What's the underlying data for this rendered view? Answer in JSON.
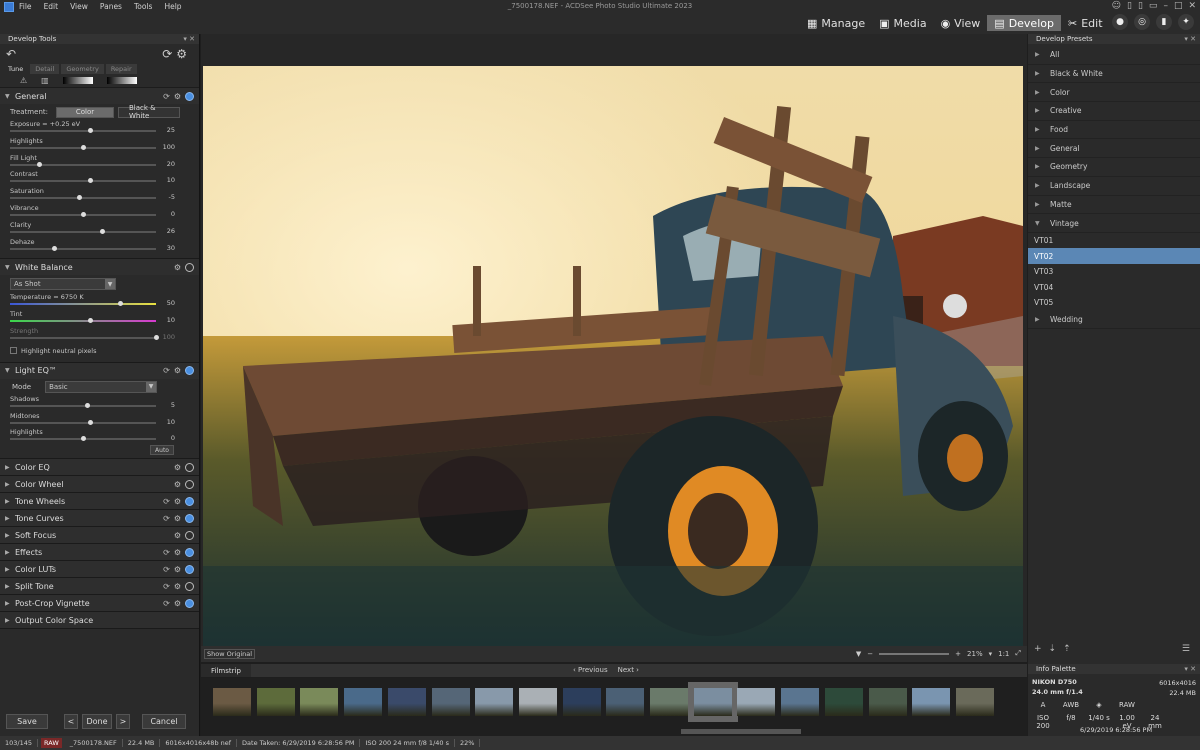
{
  "window": {
    "title": "_7500178.NEF - ACDSee Photo Studio Ultimate 2023"
  },
  "menu": [
    "File",
    "Edit",
    "View",
    "Panes",
    "Tools",
    "Help"
  ],
  "modes": [
    {
      "label": "Manage",
      "icon": "grid-icon"
    },
    {
      "label": "Media",
      "icon": "media-icon"
    },
    {
      "label": "View",
      "icon": "eye-icon"
    },
    {
      "label": "Develop",
      "icon": "develop-icon",
      "active": true
    },
    {
      "label": "Edit",
      "icon": "tools-icon"
    }
  ],
  "develop_tools": {
    "title": "Develop Tools",
    "tabs": [
      "Tune",
      "Detail",
      "Geometry",
      "Repair"
    ],
    "general": {
      "title": "General",
      "treatment_label": "Treatment:",
      "color_btn": "Color",
      "bw_btn": "Black & White",
      "sliders": [
        {
          "label": "Exposure = +0.25 eV",
          "value": "25",
          "pos": 0.55
        },
        {
          "label": "Highlights",
          "value": "100",
          "pos": 0.5
        },
        {
          "label": "Fill Light",
          "value": "20",
          "pos": 0.2
        },
        {
          "label": "Contrast",
          "value": "10",
          "pos": 0.55
        },
        {
          "label": "Saturation",
          "value": "-5",
          "pos": 0.47
        },
        {
          "label": "Vibrance",
          "value": "0",
          "pos": 0.5
        },
        {
          "label": "Clarity",
          "value": "26",
          "pos": 0.63
        },
        {
          "label": "Dehaze",
          "value": "30",
          "pos": 0.3
        }
      ]
    },
    "white_balance": {
      "title": "White Balance",
      "preset": "As Shot",
      "sliders": [
        {
          "label": "Temperature = 6750 K",
          "value": "50",
          "pos": 0.75,
          "gradient": "linear-gradient(90deg,#3a57d8,#e8e040)"
        },
        {
          "label": "Tint",
          "value": "10",
          "pos": 0.55,
          "gradient": "linear-gradient(90deg,#3ad84a,#d83ad0)"
        },
        {
          "label": "Strength",
          "value": "100",
          "pos": 1.0,
          "dim": true
        }
      ],
      "checkbox": "Highlight neutral pixels"
    },
    "light_eq": {
      "title": "Light EQ™",
      "mode_label": "Mode",
      "mode_value": "Basic",
      "sliders": [
        {
          "label": "Shadows",
          "value": "5",
          "pos": 0.53
        },
        {
          "label": "Midtones",
          "value": "10",
          "pos": 0.55
        },
        {
          "label": "Highlights",
          "value": "0",
          "pos": 0.5
        }
      ],
      "auto": "Auto"
    },
    "collapsed": [
      {
        "title": "Color EQ",
        "reset": false,
        "on": false
      },
      {
        "title": "Color Wheel",
        "reset": false,
        "on": false
      },
      {
        "title": "Tone Wheels",
        "reset": true,
        "on": true
      },
      {
        "title": "Tone Curves",
        "reset": true,
        "on": true
      },
      {
        "title": "Soft Focus",
        "reset": false,
        "on": false
      },
      {
        "title": "Effects",
        "reset": true,
        "on": true
      },
      {
        "title": "Color LUTs",
        "reset": true,
        "on": true
      },
      {
        "title": "Split Tone",
        "reset": true,
        "on": false
      },
      {
        "title": "Post-Crop Vignette",
        "reset": true,
        "on": true
      },
      {
        "title": "Output Color Space",
        "reset": false,
        "on": null
      }
    ],
    "buttons": {
      "save": "Save",
      "done": "Done",
      "cancel": "Cancel"
    }
  },
  "viewer": {
    "show_original": "Show Original",
    "zoom": "21%",
    "ratio": "1:1"
  },
  "presets": {
    "title": "Develop Presets",
    "items": [
      {
        "label": "All",
        "type": "cat"
      },
      {
        "label": "Black & White",
        "type": "cat"
      },
      {
        "label": "Color",
        "type": "cat"
      },
      {
        "label": "Creative",
        "type": "cat"
      },
      {
        "label": "Food",
        "type": "cat"
      },
      {
        "label": "General",
        "type": "cat"
      },
      {
        "label": "Geometry",
        "type": "cat"
      },
      {
        "label": "Landscape",
        "type": "cat"
      },
      {
        "label": "Matte",
        "type": "cat"
      },
      {
        "label": "Vintage",
        "type": "open"
      },
      {
        "label": "VT01",
        "type": "sub"
      },
      {
        "label": "VT02",
        "type": "sel"
      },
      {
        "label": "VT03",
        "type": "sub"
      },
      {
        "label": "VT04",
        "type": "sub"
      },
      {
        "label": "VT05",
        "type": "sub"
      },
      {
        "label": "Wedding",
        "type": "cat"
      }
    ]
  },
  "filmstrip": {
    "title": "Filmstrip",
    "previous": "Previous",
    "next": "Next",
    "thumbs": [
      "#6b5a44",
      "#5d6b3b",
      "#7a8a5a",
      "#4a6a8a",
      "#3a4a6a",
      "#556677",
      "#8899aa",
      "#aab0b5",
      "#2c3e5c",
      "#4b6075",
      "#6a7a6a",
      "#7b8ea0",
      "#9aa8b5",
      "#5a7590",
      "#2d4a3a",
      "#4a5a4a",
      "#7a95b0",
      "#6a6a5a"
    ],
    "selected_index": 11
  },
  "info": {
    "title": "Info Palette",
    "camera": "NIKON D750",
    "lens": "24.0 mm f/1.4",
    "dims": "6016x4016",
    "size": "22.4 MB",
    "mode_row": [
      "A",
      "AWB",
      "◈",
      "RAW"
    ],
    "exif": [
      "ISO 200",
      "f/8",
      "1/40 s",
      "1.00 eV",
      "24 mm"
    ],
    "date": "6/29/2019 6:28:56 PM"
  },
  "status": {
    "count": "103/145",
    "raw": "RAW",
    "file": "_7500178.NEF",
    "size": "22.4 MB",
    "dims": "6016x4016x48b nef",
    "date": "Date Taken: 6/29/2019 6:28:56 PM",
    "exif": "ISO 200   24 mm   f/8   1/40 s",
    "zoom": "22%"
  }
}
